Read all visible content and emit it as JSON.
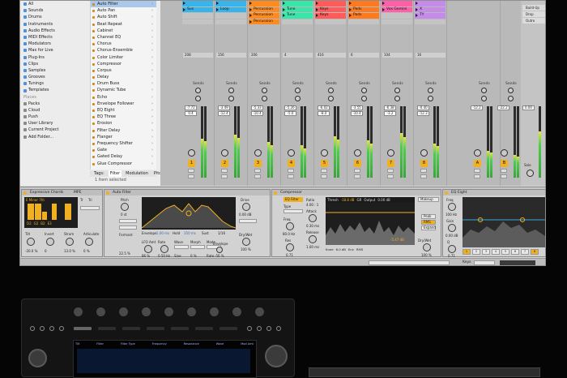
{
  "browser": {
    "categories": [
      "All",
      "Sounds",
      "Drums",
      "Instruments",
      "Audio Effects",
      "MIDI Effects",
      "Modulators",
      "Max for Live",
      "Plug-Ins",
      "Clips",
      "Samples",
      "Grooves",
      "Tunings",
      "Templates"
    ],
    "places_header": "Places",
    "places": [
      "Packs",
      "Cloud",
      "Push",
      "User Library",
      "Current Project",
      "Add Folder..."
    ],
    "effects": [
      "Auto Filter",
      "Auto Pan",
      "Auto Shift",
      "Beat Repeat",
      "Cabinet",
      "Channel EQ",
      "Chorus",
      "Chorus-Ensemble",
      "Color Limiter",
      "Compressor",
      "Corpus",
      "Delay",
      "Drum Buss",
      "Dynamic Tube",
      "Echo",
      "Envelope Follower",
      "EQ Eight",
      "EQ Three",
      "Erosion",
      "Filter Delay",
      "Flanger",
      "Frequency Shifter",
      "Gate",
      "Gated Delay",
      "Glue Compressor"
    ],
    "tags_label": "Tags:",
    "tabs": [
      "Filter",
      "Modulation",
      "Pitc"
    ],
    "status": "1 Item selected"
  },
  "tracks": [
    {
      "clips": [
        {
          "t": "",
          "c": "#37b4ea"
        },
        {
          "t": "Sus",
          "c": "#37b4ea"
        },
        {
          "t": "",
          "c": ""
        },
        {
          "t": "",
          "c": ""
        }
      ],
      "num": "1",
      "vol": "-7.72",
      "vol2": "0.4",
      "level": 0.55,
      "color": "#f0b020"
    },
    {
      "clips": [
        {
          "t": "",
          "c": "#37b4ea"
        },
        {
          "t": "Loop",
          "c": "#37b4ea"
        },
        {
          "t": "",
          "c": ""
        },
        {
          "t": "",
          "c": ""
        }
      ],
      "num": "2",
      "vol": "-3.49",
      "vol2": "-12.4",
      "level": 0.6,
      "color": "#f0b020"
    },
    {
      "clips": [
        {
          "t": "",
          "c": "#ff8a1e"
        },
        {
          "t": "Percussion",
          "c": "#ff8a1e"
        },
        {
          "t": "Percussion",
          "c": "#ff8a1e"
        },
        {
          "t": "Percussion",
          "c": "#ff8a1e"
        }
      ],
      "num": "3",
      "vol": "-5.33",
      "vol2": "-10.4",
      "level": 0.5,
      "color": "#f0b020"
    },
    {
      "clips": [
        {
          "t": "",
          "c": "#37e6a8"
        },
        {
          "t": "Tune",
          "c": "#37e6a8"
        },
        {
          "t": "Tune",
          "c": "#37e6a8"
        },
        {
          "t": "",
          "c": ""
        }
      ],
      "num": "4",
      "vol": "-5.26",
      "vol2": "-5.0",
      "level": 0.45,
      "color": "#f0b020"
    },
    {
      "clips": [
        {
          "t": "",
          "c": "#ff5b5b"
        },
        {
          "t": "Keys",
          "c": "#ff5b5b"
        },
        {
          "t": "Keys",
          "c": "#ff5b5b"
        },
        {
          "t": "",
          "c": ""
        }
      ],
      "num": "5",
      "vol": "-6.02",
      "vol2": "-8.0",
      "level": 0.58,
      "color": "#f0b020"
    },
    {
      "clips": [
        {
          "t": "",
          "c": "#ff7a1e"
        },
        {
          "t": "Pads",
          "c": "#ff7a1e"
        },
        {
          "t": "Pads",
          "c": "#ff7a1e"
        },
        {
          "t": "",
          "c": ""
        }
      ],
      "num": "6",
      "vol": "-3.55",
      "vol2": "-10.4",
      "level": 0.52,
      "color": "#f0b020"
    },
    {
      "clips": [
        {
          "t": "",
          "c": "#ff5fa8"
        },
        {
          "t": "Vox Gemini",
          "c": "#ff5fa8"
        },
        {
          "t": "",
          "c": ""
        },
        {
          "t": "",
          "c": ""
        }
      ],
      "num": "7",
      "vol": "-6.38",
      "vol2": "-3.2",
      "level": 0.62,
      "color": "#f0b020"
    },
    {
      "clips": [
        {
          "t": "",
          "c": "#c48be8"
        },
        {
          "t": "X",
          "c": "#c48be8"
        },
        {
          "t": "TY",
          "c": "#c48be8"
        },
        {
          "t": "",
          "c": ""
        }
      ],
      "num": "8",
      "vol": "-0.40",
      "vol2": "-12.3",
      "level": 0.48,
      "color": "#f0b020"
    }
  ],
  "returns": [
    {
      "num": "A",
      "vol": "-12.2",
      "level": 0.38
    },
    {
      "num": "B",
      "vol": "-22.2",
      "level": 0.32
    }
  ],
  "master": {
    "scenes": [
      "Build-Up",
      "Drop",
      "Outro"
    ],
    "vol": "0.00",
    "level": 0.65,
    "label": "Solo"
  },
  "sends_label": "Sends",
  "io_values": [
    "208",
    "156",
    "206",
    "4",
    "416",
    "6",
    "104",
    "16"
  ],
  "devices": {
    "chords": {
      "title": "Expressive Chords",
      "display": "E Minor 7th",
      "mpe": "MPE",
      "chord": "Tri",
      "notes": [
        "D2",
        "G2",
        "B2",
        "E3"
      ],
      "params": [
        "Tilt",
        "Invert",
        "Strum",
        "Articulate"
      ],
      "values": [
        "-20.0 %",
        "0",
        "13.0 %",
        "0 %"
      ],
      "mode_label": "Tr"
    },
    "autofilter": {
      "title": "Auto Filter",
      "knobs": [
        "Pitch",
        "Freq",
        "Res",
        "Formant"
      ],
      "values": [
        "0 st",
        "",
        "",
        "22.5 %"
      ],
      "envelope": "Envelope",
      "env_values": [
        "1.00 ms",
        "Hold",
        "350 ms",
        "Sust",
        "1/16"
      ],
      "lfo": [
        "LFO Amt",
        "Rate",
        "Wave",
        "Morph",
        "Mode"
      ],
      "lfo_values": [
        "86 %",
        "0.50 Hz",
        "Sine",
        "0 %",
        "Rate"
      ],
      "drive": "Drive",
      "drive_val": "0.00 dB",
      "dw": "Dry/Wet",
      "dw_val": "100 %",
      "env_amt": "Envelope",
      "env_amt_val": "-56 %"
    },
    "compressor": {
      "title": "Compressor",
      "eq": "EQ Filter",
      "type": "Type",
      "freq": "Freq",
      "freq_val": "80.0 Hz",
      "res": "Res",
      "res_val": "0.71",
      "ratio": "Ratio",
      "ratio_val": "4.00 : 1",
      "attack": "Attack",
      "attack_val": "0.30 ms",
      "release": "Release",
      "release_val": "1.00 ms",
      "thresh": "Thresh",
      "thresh_val": "-18.8 dB",
      "gr": "GR",
      "out": "Output",
      "out_val": "0.00 dB",
      "knee": "Knee",
      "knee_val": "6.0 dB",
      "env": "Env",
      "env_val": "RMS",
      "lookahead": "Lookahead",
      "makeup": "Makeup",
      "dw": "Dry/Wet",
      "dw_val": "100 %",
      "peak": "Peak",
      "rms": "RMS",
      "expand": "Expand",
      "mix": "-5.47 dB"
    },
    "eq": {
      "title": "EQ Eight",
      "freq": "Freq",
      "freq_val": "100 Hz",
      "gain": "Gain",
      "gain_val": "0.00 dB",
      "q": "Q",
      "q_val": "0.71",
      "bands": [
        "1",
        "2",
        "3",
        "4",
        "5",
        "6",
        "7",
        "8"
      ]
    }
  },
  "status": {
    "track_name": "Keys"
  },
  "hardware": {
    "screen_labels": [
      "Tilt",
      "Filter",
      "Filter Type",
      "Frequency",
      "Resonance",
      "Wave",
      "Mod Amt"
    ]
  }
}
